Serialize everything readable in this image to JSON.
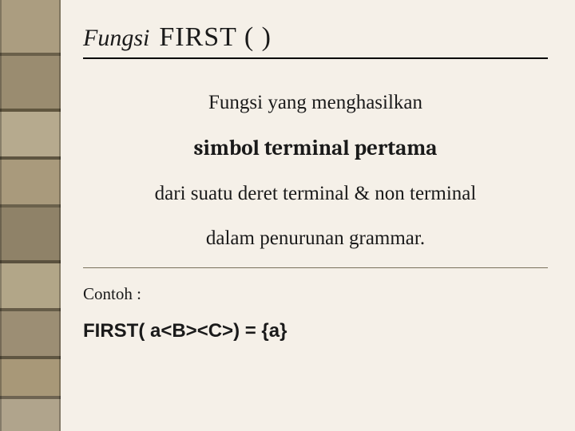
{
  "title": {
    "label": "Fungsi",
    "func": "FIRST ( )"
  },
  "body": {
    "line1": "Fungsi yang menghasilkan",
    "line2_bold": "simbol terminal pertama",
    "line3": "dari suatu deret terminal & non terminal",
    "line4": "dalam penurunan grammar."
  },
  "example": {
    "label": "Contoh :",
    "expr": "FIRST( a<B><C>) = {a}"
  }
}
